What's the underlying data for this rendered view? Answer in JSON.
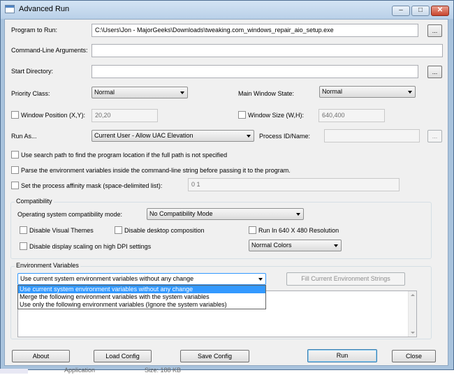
{
  "window": {
    "title": "Advanced Run",
    "minimize": "–",
    "maximize": "□",
    "close": "✕"
  },
  "program_to_run": {
    "label": "Program to Run:",
    "value": "C:\\Users\\Jon - MajorGeeks\\Downloads\\tweaking.com_windows_repair_aio_setup.exe",
    "browse": "..."
  },
  "command_line": {
    "label": "Command-Line Arguments:",
    "value": ""
  },
  "start_directory": {
    "label": "Start Directory:",
    "value": "",
    "browse": "..."
  },
  "priority_class": {
    "label": "Priority Class:",
    "value": "Normal"
  },
  "main_window_state": {
    "label": "Main Window State:",
    "value": "Normal"
  },
  "window_position": {
    "label": "Window Position (X,Y):",
    "value": "20,20",
    "checked": false
  },
  "window_size": {
    "label": "Window Size (W,H):",
    "value": "640,400",
    "checked": false
  },
  "run_as": {
    "label": "Run As...",
    "value": "Current User - Allow UAC Elevation"
  },
  "process_id": {
    "label": "Process ID/Name:",
    "value": "",
    "browse": "..."
  },
  "options": {
    "search_path": "Use search path to find the program location if the full path is not specified",
    "parse_env": "Parse the environment variables inside the command-line string before passing it to the program.",
    "affinity": "Set the process affinity mask (space-delimited list):",
    "affinity_value": "0 1"
  },
  "compatibility": {
    "title": "Compatibility",
    "mode_label": "Operating system compatibility mode:",
    "mode_value": "No Compatibility Mode",
    "disable_visual_themes": "Disable Visual Themes",
    "disable_desktop_composition": "Disable desktop composition",
    "run_640x480": "Run In 640 X 480 Resolution",
    "disable_dpi_scaling": "Disable display scaling on high DPI settings",
    "colors_value": "Normal Colors"
  },
  "environment": {
    "title": "Environment Variables",
    "selected": "Use current system environment variables without any change",
    "options": [
      "Use current system environment variables without any change",
      "Merge the following environment variables with the system variables",
      "Use only the following environment variables (Ignore the  system variables)"
    ],
    "fill_button": "Fill Current Environment Strings"
  },
  "buttons": {
    "about": "About",
    "load_config": "Load Config",
    "save_config": "Save Config",
    "run": "Run",
    "close": "Close"
  },
  "behind_window": {
    "text_left": "Application",
    "text_right": "Size: 188 KB"
  }
}
